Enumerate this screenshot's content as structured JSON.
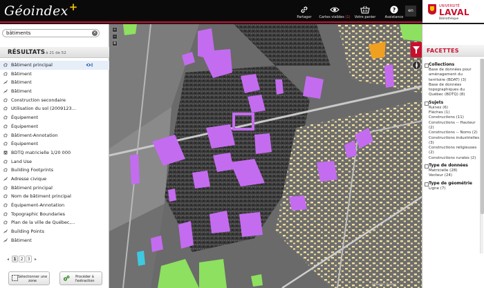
{
  "header": {
    "logo_text": "Géoindex",
    "logo_plus": "+",
    "tools": [
      {
        "label": "Partager",
        "icon": "link-icon"
      },
      {
        "label": "Cartes visibles",
        "count": "(1)",
        "icon": "eye-icon"
      },
      {
        "label": "Votre panier",
        "icon": "basket-icon"
      },
      {
        "label": "Assistance",
        "icon": "help-icon"
      }
    ],
    "lang": "en",
    "university": {
      "small": "UNIVERSITÉ",
      "big": "LAVAL",
      "sub": "Bibliothèque"
    }
  },
  "search": {
    "value": "bâtiments",
    "clear": "×"
  },
  "results": {
    "title": "RÉSULTATS",
    "range": "1 à 21 de 52",
    "items": [
      {
        "label": "Bâtiment principal",
        "icon": "polygon-icon"
      },
      {
        "label": "Bâtiment",
        "icon": "polygon-icon"
      },
      {
        "label": "Bâtiment",
        "icon": "line-icon"
      },
      {
        "label": "Bâtiment",
        "icon": "line-icon"
      },
      {
        "label": "Construction secondaire",
        "icon": "polygon-icon"
      },
      {
        "label": "Utilisation du sol (2009123...",
        "icon": "polygon-icon"
      },
      {
        "label": "Équipement",
        "icon": "polygon-icon"
      },
      {
        "label": "Équipement",
        "icon": "polygon-icon"
      },
      {
        "label": "Bâtiment-Annotation",
        "icon": "polygon-icon"
      },
      {
        "label": "Équipement",
        "icon": "polygon-icon"
      },
      {
        "label": "BDTQ matricielle 1/20 000",
        "icon": "raster-icon"
      },
      {
        "label": "Land Use",
        "icon": "polygon-icon"
      },
      {
        "label": "Building Footprints",
        "icon": "polygon-icon"
      },
      {
        "label": "Adresse civique",
        "icon": "line-icon"
      },
      {
        "label": "Bâtiment principal",
        "icon": "polygon-icon"
      },
      {
        "label": "Nom de bâtiment principal",
        "icon": "polygon-icon"
      },
      {
        "label": "Équipement-Annotation",
        "icon": "polygon-icon"
      },
      {
        "label": "Topographic Boundaries",
        "icon": "polygon-icon"
      },
      {
        "label": "Plan de la ville de Québec,...",
        "icon": "polygon-icon"
      },
      {
        "label": "Building Points",
        "icon": "line-icon"
      },
      {
        "label": "Bâtiment",
        "icon": "line-icon"
      }
    ]
  },
  "pager": {
    "prev": "◂",
    "pages": [
      "1",
      "2",
      "3"
    ],
    "next": "▸"
  },
  "buttons": {
    "select_zone": "Sélectionner une zone",
    "extract": "Procéder à l'extraction"
  },
  "facets": {
    "title": "FACETTES",
    "groups": [
      {
        "title": "Collections",
        "items": [
          "Base de données pour aménagement du territoire (BDAT) (3)",
          "Base de données topographiques du Québec (BDTQ) (8)"
        ]
      },
      {
        "title": "Sujets",
        "items": [
          "Ruines (6)",
          "Flèches (1)",
          "Constructions (11)",
          "Constructions -- Hauteur (2)",
          "Constructions -- Noms (2)",
          "Constructions industrielles (3)",
          "Constructions religieuses (2)",
          "Constructions rurales (2)"
        ]
      },
      {
        "title": "Type de données",
        "items": [
          "Matricielle (28)",
          "Vecteur (24)"
        ]
      },
      {
        "title": "Type de géométrie",
        "items": [
          "Ligne (7)"
        ]
      }
    ]
  },
  "map": {
    "credit": "Diffusion, Québec"
  },
  "colors": {
    "accent": "#c8102e",
    "building": "#c46cf0",
    "green": "#8ee060",
    "orange": "#f0a020"
  }
}
